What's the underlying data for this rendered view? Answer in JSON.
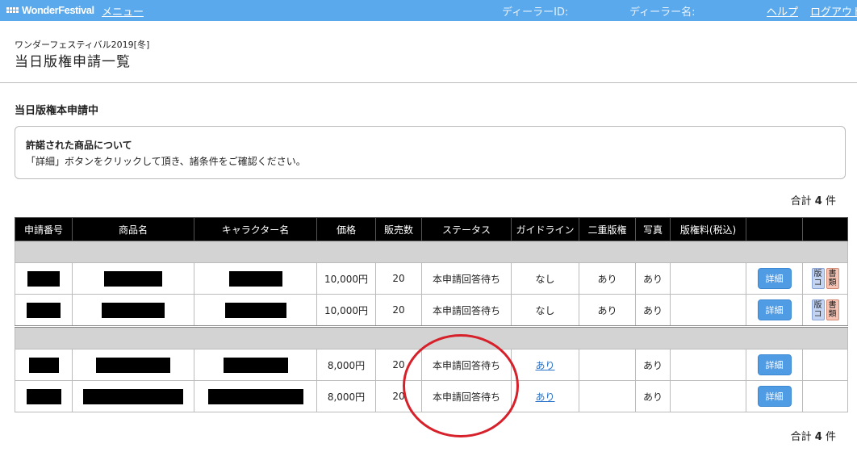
{
  "header": {
    "logo_text": "WonderFestival",
    "menu_label": "メニュー",
    "dealer_id_label": "ディーラーID:",
    "dealer_name_label": "ディーラー名:",
    "help_label": "ヘルプ",
    "logout_label": "ログアウト"
  },
  "page": {
    "event_name": "ワンダーフェスティバル2019[冬]",
    "title": "当日版権申請一覧",
    "section_title": "当日版権本申請中"
  },
  "notice": {
    "title": "許諾された商品について",
    "body": "「詳細」ボタンをクリックして頂き、諸条件をご確認ください。"
  },
  "totals": {
    "prefix": "合計",
    "count": "4",
    "suffix": "件"
  },
  "table": {
    "columns": [
      "申請番号",
      "商品名",
      "キャラクター名",
      "価格",
      "販売数",
      "ステータス",
      "ガイドライン",
      "二重版権",
      "写真",
      "版権料(税込)",
      "",
      ""
    ],
    "rows": [
      {
        "price": "10,000円",
        "qty": "20",
        "status": "本申請回答待ち",
        "guideline": "なし",
        "double": "あり",
        "photo": "あり",
        "fee": "",
        "button": "詳細",
        "tag1a": "版",
        "tag1b": "コ",
        "tag2a": "書",
        "tag2b": "類"
      },
      {
        "price": "10,000円",
        "qty": "20",
        "status": "本申請回答待ち",
        "guideline": "なし",
        "double": "あり",
        "photo": "あり",
        "fee": "",
        "button": "詳細",
        "tag1a": "版",
        "tag1b": "コ",
        "tag2a": "書",
        "tag2b": "類"
      },
      {
        "price": "8,000円",
        "qty": "20",
        "status": "本申請回答待ち",
        "guideline": "あり",
        "double": "",
        "photo": "あり",
        "fee": "",
        "button": "詳細"
      },
      {
        "price": "8,000円",
        "qty": "20",
        "status": "本申請回答待ち",
        "guideline": "あり",
        "double": "",
        "photo": "あり",
        "fee": "",
        "button": "詳細"
      }
    ]
  },
  "colors": {
    "header_bg": "#5aa9ec",
    "button": "#4f9be4",
    "annotation_circle": "#d6202a"
  }
}
